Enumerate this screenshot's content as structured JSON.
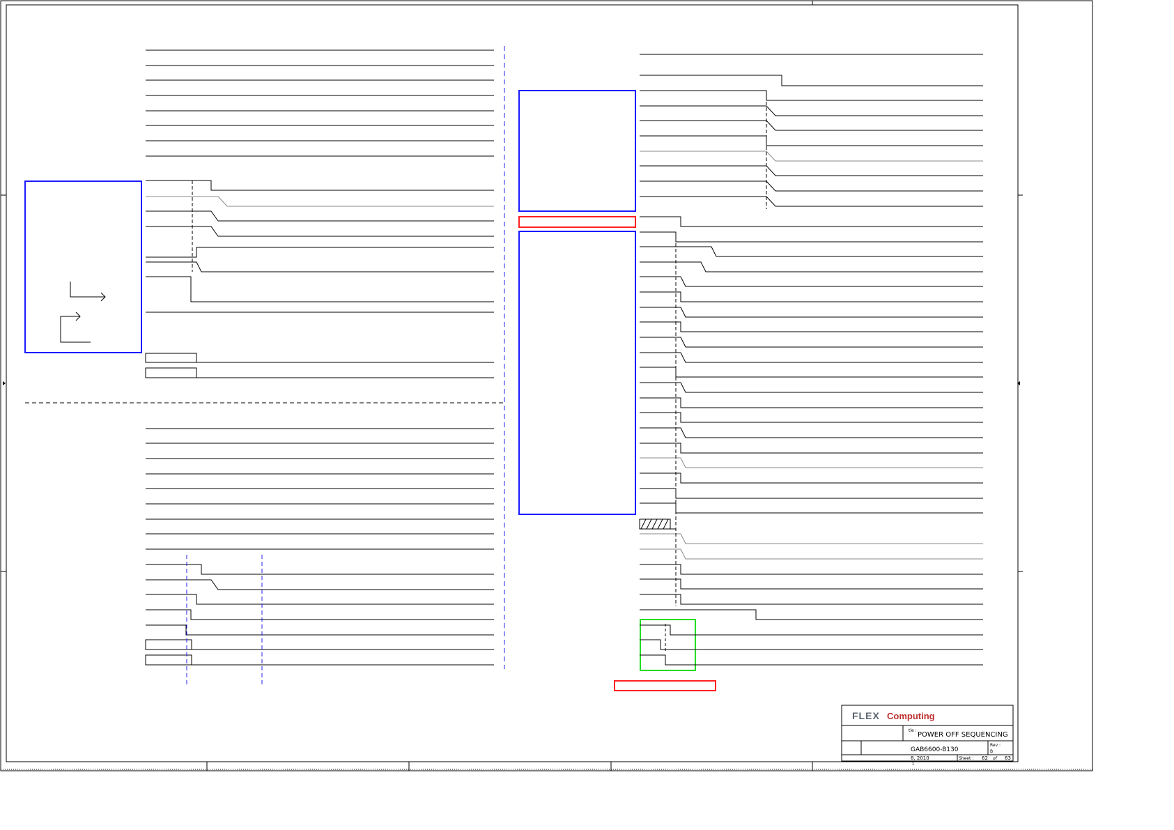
{
  "title_block": {
    "logo_flex": "FLEX",
    "logo_computing": "Computing",
    "title_field_label": "tle :",
    "title": "POWER OFF SEQUENCING",
    "doc_number": "GAB6600-B130",
    "rev_label": "Rev :",
    "rev_value": "B",
    "date": "8, 2010",
    "sheet_label": "Sheet :",
    "sheet_number": "62",
    "of_label": "of",
    "total_sheets": "63",
    "footer_mark": "1"
  },
  "colors": {
    "line": "#000000",
    "blue_box": "#1a1aff",
    "blue_dash": "#2222ee",
    "red_box": "#ff2020",
    "green_box": "#22dd22",
    "logo_dark": "#5a6470",
    "logo_red": "#c03030"
  }
}
